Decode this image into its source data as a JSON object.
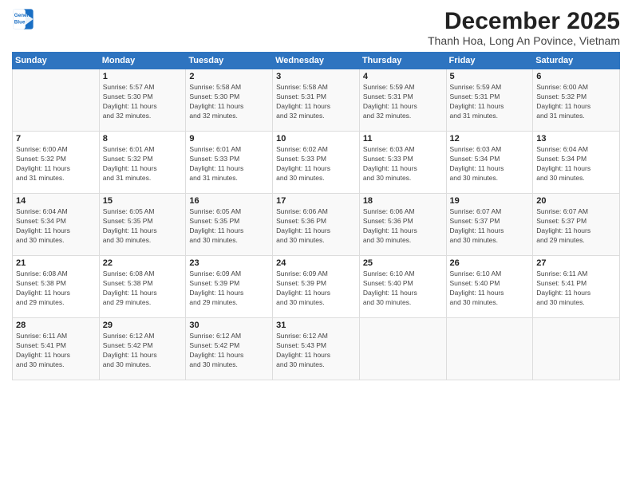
{
  "logo": {
    "line1": "General",
    "line2": "Blue"
  },
  "title": "December 2025",
  "subtitle": "Thanh Hoa, Long An Povince, Vietnam",
  "days_header": [
    "Sunday",
    "Monday",
    "Tuesday",
    "Wednesday",
    "Thursday",
    "Friday",
    "Saturday"
  ],
  "weeks": [
    [
      {
        "num": "",
        "info": ""
      },
      {
        "num": "1",
        "info": "Sunrise: 5:57 AM\nSunset: 5:30 PM\nDaylight: 11 hours\nand 32 minutes."
      },
      {
        "num": "2",
        "info": "Sunrise: 5:58 AM\nSunset: 5:30 PM\nDaylight: 11 hours\nand 32 minutes."
      },
      {
        "num": "3",
        "info": "Sunrise: 5:58 AM\nSunset: 5:31 PM\nDaylight: 11 hours\nand 32 minutes."
      },
      {
        "num": "4",
        "info": "Sunrise: 5:59 AM\nSunset: 5:31 PM\nDaylight: 11 hours\nand 32 minutes."
      },
      {
        "num": "5",
        "info": "Sunrise: 5:59 AM\nSunset: 5:31 PM\nDaylight: 11 hours\nand 31 minutes."
      },
      {
        "num": "6",
        "info": "Sunrise: 6:00 AM\nSunset: 5:32 PM\nDaylight: 11 hours\nand 31 minutes."
      }
    ],
    [
      {
        "num": "7",
        "info": "Sunrise: 6:00 AM\nSunset: 5:32 PM\nDaylight: 11 hours\nand 31 minutes."
      },
      {
        "num": "8",
        "info": "Sunrise: 6:01 AM\nSunset: 5:32 PM\nDaylight: 11 hours\nand 31 minutes."
      },
      {
        "num": "9",
        "info": "Sunrise: 6:01 AM\nSunset: 5:33 PM\nDaylight: 11 hours\nand 31 minutes."
      },
      {
        "num": "10",
        "info": "Sunrise: 6:02 AM\nSunset: 5:33 PM\nDaylight: 11 hours\nand 30 minutes."
      },
      {
        "num": "11",
        "info": "Sunrise: 6:03 AM\nSunset: 5:33 PM\nDaylight: 11 hours\nand 30 minutes."
      },
      {
        "num": "12",
        "info": "Sunrise: 6:03 AM\nSunset: 5:34 PM\nDaylight: 11 hours\nand 30 minutes."
      },
      {
        "num": "13",
        "info": "Sunrise: 6:04 AM\nSunset: 5:34 PM\nDaylight: 11 hours\nand 30 minutes."
      }
    ],
    [
      {
        "num": "14",
        "info": "Sunrise: 6:04 AM\nSunset: 5:34 PM\nDaylight: 11 hours\nand 30 minutes."
      },
      {
        "num": "15",
        "info": "Sunrise: 6:05 AM\nSunset: 5:35 PM\nDaylight: 11 hours\nand 30 minutes."
      },
      {
        "num": "16",
        "info": "Sunrise: 6:05 AM\nSunset: 5:35 PM\nDaylight: 11 hours\nand 30 minutes."
      },
      {
        "num": "17",
        "info": "Sunrise: 6:06 AM\nSunset: 5:36 PM\nDaylight: 11 hours\nand 30 minutes."
      },
      {
        "num": "18",
        "info": "Sunrise: 6:06 AM\nSunset: 5:36 PM\nDaylight: 11 hours\nand 30 minutes."
      },
      {
        "num": "19",
        "info": "Sunrise: 6:07 AM\nSunset: 5:37 PM\nDaylight: 11 hours\nand 30 minutes."
      },
      {
        "num": "20",
        "info": "Sunrise: 6:07 AM\nSunset: 5:37 PM\nDaylight: 11 hours\nand 29 minutes."
      }
    ],
    [
      {
        "num": "21",
        "info": "Sunrise: 6:08 AM\nSunset: 5:38 PM\nDaylight: 11 hours\nand 29 minutes."
      },
      {
        "num": "22",
        "info": "Sunrise: 6:08 AM\nSunset: 5:38 PM\nDaylight: 11 hours\nand 29 minutes."
      },
      {
        "num": "23",
        "info": "Sunrise: 6:09 AM\nSunset: 5:39 PM\nDaylight: 11 hours\nand 29 minutes."
      },
      {
        "num": "24",
        "info": "Sunrise: 6:09 AM\nSunset: 5:39 PM\nDaylight: 11 hours\nand 30 minutes."
      },
      {
        "num": "25",
        "info": "Sunrise: 6:10 AM\nSunset: 5:40 PM\nDaylight: 11 hours\nand 30 minutes."
      },
      {
        "num": "26",
        "info": "Sunrise: 6:10 AM\nSunset: 5:40 PM\nDaylight: 11 hours\nand 30 minutes."
      },
      {
        "num": "27",
        "info": "Sunrise: 6:11 AM\nSunset: 5:41 PM\nDaylight: 11 hours\nand 30 minutes."
      }
    ],
    [
      {
        "num": "28",
        "info": "Sunrise: 6:11 AM\nSunset: 5:41 PM\nDaylight: 11 hours\nand 30 minutes."
      },
      {
        "num": "29",
        "info": "Sunrise: 6:12 AM\nSunset: 5:42 PM\nDaylight: 11 hours\nand 30 minutes."
      },
      {
        "num": "30",
        "info": "Sunrise: 6:12 AM\nSunset: 5:42 PM\nDaylight: 11 hours\nand 30 minutes."
      },
      {
        "num": "31",
        "info": "Sunrise: 6:12 AM\nSunset: 5:43 PM\nDaylight: 11 hours\nand 30 minutes."
      },
      {
        "num": "",
        "info": ""
      },
      {
        "num": "",
        "info": ""
      },
      {
        "num": "",
        "info": ""
      }
    ]
  ]
}
